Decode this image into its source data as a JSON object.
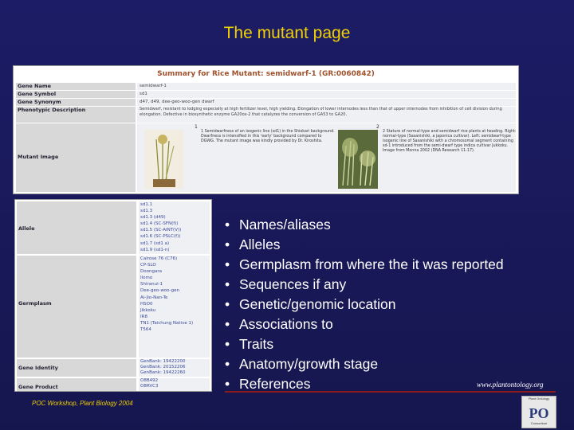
{
  "slide": {
    "title": "The mutant page",
    "footer": "POC Workshop, Plant Biology 2004",
    "url": "www.plantontology.org",
    "logo_text": "PO",
    "logo_top": "Plant Ontology",
    "logo_bottom": "Consortium"
  },
  "summary": {
    "header": "Summary for Rice Mutant: semidwarf-1 (GR:0060842)",
    "rows": [
      {
        "label": "Gene Name",
        "value": "semidwarf-1"
      },
      {
        "label": "Gene Symbol",
        "value": "sd1"
      },
      {
        "label": "Gene Synonym",
        "value": "d47, d49, dee-geo-woo-gen dwarf"
      },
      {
        "label": "Phenotypic Description",
        "value": "Semidwarf, resistant to lodging especially at high fertilizer level, high yielding. Elongation of lower internodes less than that of upper internodes from inhibition of cell division during elongation. Defective in biosynthetic enzyme GA20ox-2 that catalyzes the conversion of GA53 to GA20."
      },
      {
        "label": "Mutant Image",
        "value": ""
      }
    ],
    "image1_num": "1",
    "image1_caption": "1 Semidwarfness of an isogenic line (sd1) in the Shiokari background. Dwarfness is intensified in this 'early' background compared to DGWG. The mutant image was kindly provided by Dr. Kiroshita.",
    "image2_num": "2",
    "image2_caption": "2 Stature of normal-type and semidwarf rice plants at heading. Right: normal-type (Sasanishiki, a japonica cultivar). Left: semidwarf-type isogenic line of Sasanishiki with a chromosomal segment containing sd-1 introduced from the semi-dwarf type indica cultivar Jukkoku. Image from Monna 2002 (DNA Research 11-17)."
  },
  "details": {
    "allele_label": "Allele",
    "alleles": [
      "sd1.1",
      "sd1.3",
      "sd1.3 (d49)",
      "sd1.4 (SC-SFN(f))",
      "sd1.5 (SC-AINT(V))",
      "sd1.6 (SC-PSLC(f))",
      "sd1.7 (sd1 a)",
      "sd1.9 (sd1-n)"
    ],
    "germplasm_label": "Germplasm",
    "germplasm": [
      "Calrose 76 (C76)",
      "CP-SLO",
      "Doongara",
      "Ilomo",
      "Shiranui-1",
      "Dee-geo-woo-gen",
      "Ai-Jio-Nan-Te",
      "HSO0",
      "Jikkoku",
      "IR8",
      "TN1 (Taichung Native 1)",
      "T564"
    ],
    "identity_label": "Gene Identity",
    "identity": [
      "GenBank: 19422200",
      "GenBank: 20152206",
      "GenBank: 19422260"
    ],
    "product_label": "Gene Product",
    "product": [
      "O8B492",
      "O8RVC3"
    ]
  },
  "bullets": [
    "Names/aliases",
    "Alleles",
    "Germplasm from where the it was reported",
    "Sequences if any",
    "Genetic/genomic location",
    "Associations to",
    "Traits",
    "Anatomy/growth stage",
    "References"
  ],
  "colors": {
    "background": "#1a1a5e",
    "title": "#f0d000",
    "bullet_text": "#ffffff",
    "rule": "#8b1a1a"
  }
}
